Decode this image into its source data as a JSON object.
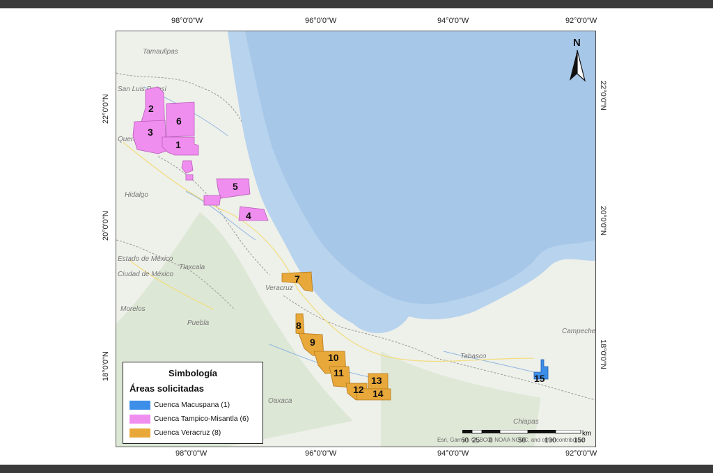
{
  "frame": {
    "top_bar_color": "#3a3a3a",
    "bottom_bar_color": "#3a3a3a"
  },
  "axes": {
    "top": [
      "98°0'0\"W",
      "96°0'0\"W",
      "94°0'0\"W",
      "92°0'0\"W"
    ],
    "bottom": [
      "98°0'0\"W",
      "96°0'0\"W",
      "94°0'0\"W",
      "92°0'0\"W"
    ],
    "left": [
      "22°0'0\"N",
      "20°0'0\"N",
      "18°0'0\"N"
    ],
    "right": [
      "22°0'0\"N",
      "20°0'0\"N",
      "18°0'0\"N"
    ]
  },
  "places": {
    "tamaulipas": "Tamaulipas",
    "san_luis": "San Luis Potosí",
    "queretaro": "Querétaro",
    "hidalgo": "Hidalgo",
    "edo_mexico": "Estado de México",
    "ciudad_mexico": "Ciudad de México",
    "tlaxcala": "Tlaxcala",
    "morelos": "Morelos",
    "puebla": "Puebla",
    "veracruz": "Veracruz",
    "oaxaca": "Oaxaca",
    "tabasco": "Tabasco",
    "chiapas": "Chiapas",
    "campeche": "Campeche"
  },
  "blocks": {
    "b1": "1",
    "b2": "2",
    "b3": "3",
    "b4": "4",
    "b5": "5",
    "b6": "6",
    "b7": "7",
    "b8": "8",
    "b9": "9",
    "b10": "10",
    "b11": "11",
    "b12": "12",
    "b13": "13",
    "b14": "14",
    "b15": "15"
  },
  "legend": {
    "title": "Simbología",
    "subtitle": "Áreas solicitadas",
    "items": [
      {
        "label": "Cuenca Macuspana (1)",
        "color": "#3d8ee8"
      },
      {
        "label": "Cuenca Tampico-Misantla (6)",
        "color": "#f08ef0"
      },
      {
        "label": "Cuenca Veracruz (8)",
        "color": "#e8a83a"
      }
    ]
  },
  "north_arrow": {
    "label": "N"
  },
  "scale": {
    "ticks": [
      "50",
      "25",
      "0",
      "50",
      "100",
      "150"
    ],
    "unit": "km"
  },
  "credit": "Esri, Garmin, GEBCO, NOAA NGDC, and other contributors",
  "colors": {
    "sea": "#b7d3ee",
    "land": "#eef0ea",
    "magenta": "#f08ef0",
    "orange": "#e8a83a",
    "blue": "#3d8ee8"
  }
}
